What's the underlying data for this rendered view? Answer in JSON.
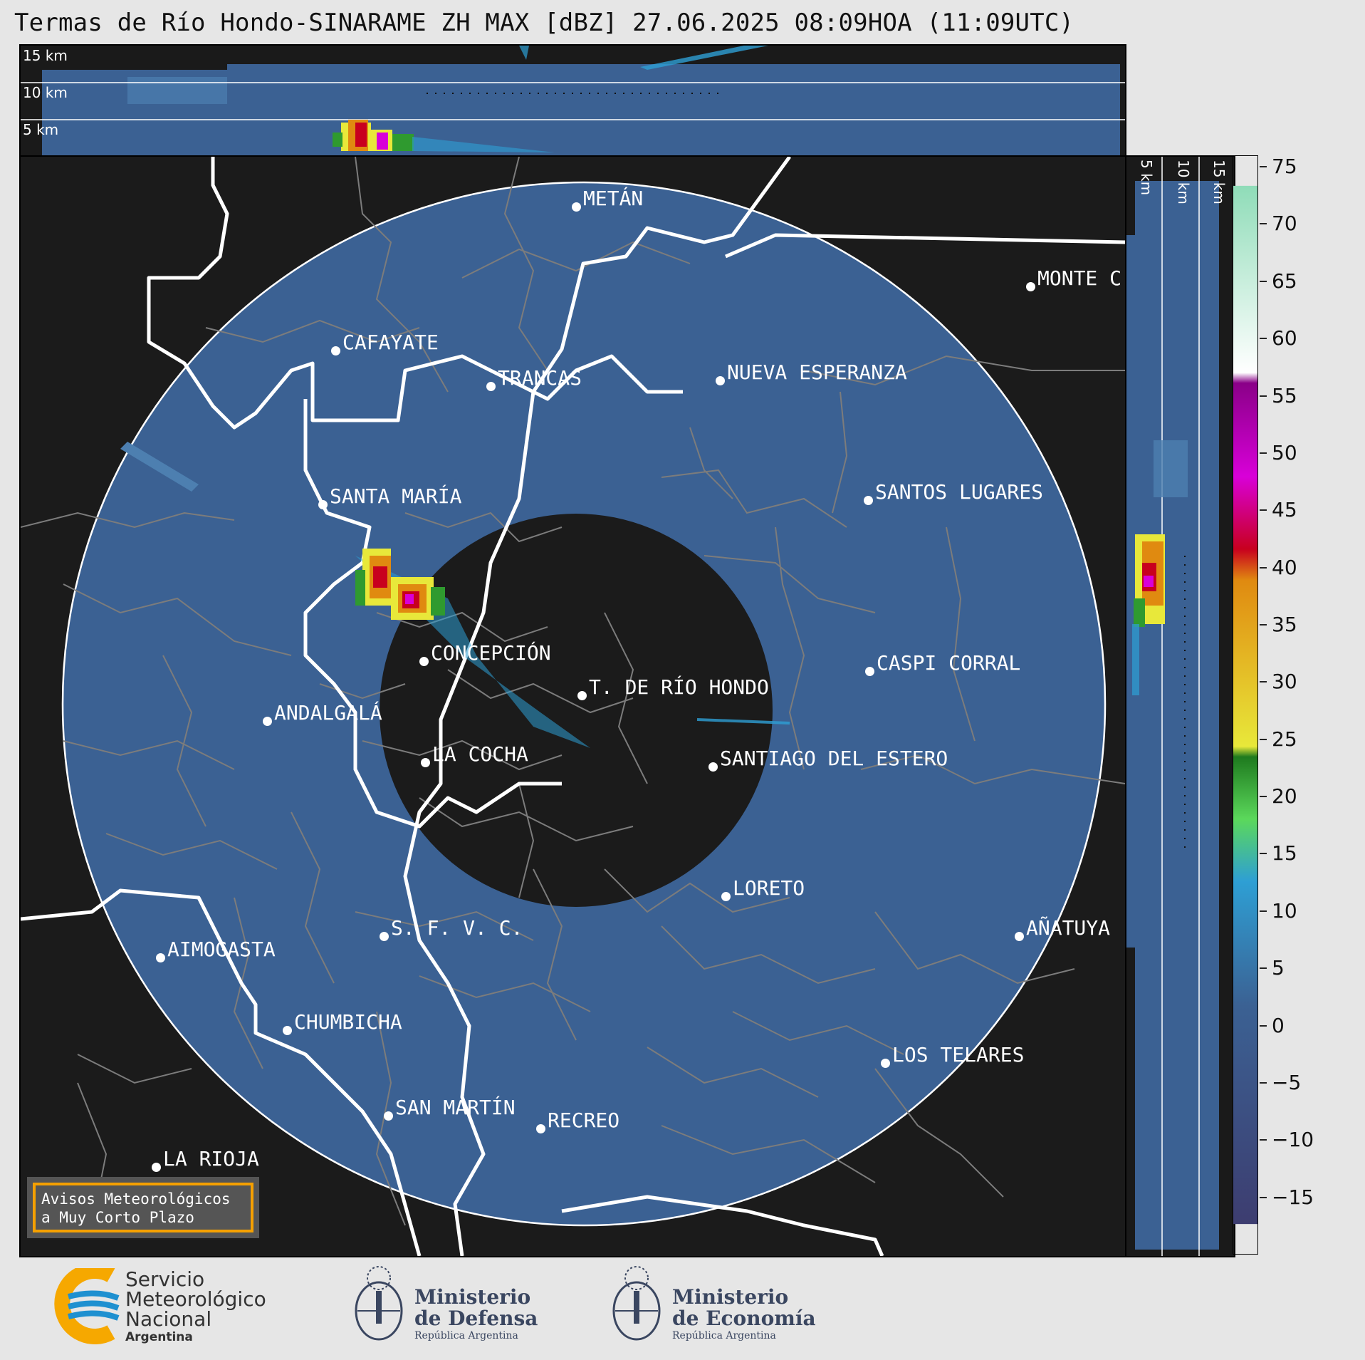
{
  "title": "Termas de Río Hondo-SINARAME ZH MAX [dBZ] 27.06.2025 08:09HOA (11:09UTC)",
  "top_panel": {
    "altitude_labels": [
      "15 km",
      "10 km",
      "5 km"
    ]
  },
  "right_panel": {
    "altitude_labels": [
      "5 km",
      "10 km",
      "15 km"
    ]
  },
  "cities": [
    {
      "name": "METÁN"
    },
    {
      "name": "MONTE C"
    },
    {
      "name": "CAFAYATE"
    },
    {
      "name": "TRANCAS"
    },
    {
      "name": "NUEVA ESPERANZA"
    },
    {
      "name": "SANTA MARÍA"
    },
    {
      "name": "SANTOS LUGARES"
    },
    {
      "name": "CONCEPCIÓN"
    },
    {
      "name": "CASPI CORRAL"
    },
    {
      "name": "T. DE RÍO HONDO"
    },
    {
      "name": "ANDALGALÁ"
    },
    {
      "name": "LA COCHA"
    },
    {
      "name": "SANTIAGO DEL ESTERO"
    },
    {
      "name": "LORETO"
    },
    {
      "name": "S. F. V. C."
    },
    {
      "name": "AÑATUYA"
    },
    {
      "name": "AIMOGASTA"
    },
    {
      "name": "CHUMBICHA"
    },
    {
      "name": "LOS TELARES"
    },
    {
      "name": "SAN MARTÍN"
    },
    {
      "name": "RECREO"
    },
    {
      "name": "LA RIOJA"
    }
  ],
  "warning_box": {
    "line1": "Avisos Meteorológicos",
    "line2": "a Muy Corto Plazo"
  },
  "colorbar": {
    "unit": "dBZ",
    "min": -20,
    "max": 76,
    "tick_values": [
      75,
      70,
      65,
      60,
      55,
      50,
      45,
      40,
      35,
      30,
      25,
      20,
      15,
      10,
      5,
      0,
      -5,
      -10,
      -15
    ],
    "tick_labels": [
      "75",
      "70",
      "65",
      "60",
      "55",
      "50",
      "45",
      "40",
      "35",
      "30",
      "25",
      "20",
      "15",
      "10",
      "5",
      "0",
      "−5",
      "−10",
      "−15"
    ],
    "colors": {
      "low_dark": "#3d3d70",
      "blue_base": "#3b6193",
      "light_blue": "#2e9fd4",
      "green": "#2f9a2f",
      "yellow": "#e8e83a",
      "orange": "#e08a10",
      "red": "#c8001e",
      "magenta": "#d800d8",
      "white": "#ffffff",
      "mint": "#8fdcb8"
    }
  },
  "logos": {
    "smn": {
      "line1": "Servicio",
      "line2": "Meteorológico",
      "line3": "Nacional",
      "line4": "Argentina"
    },
    "defensa": {
      "line1": "Ministerio",
      "line2": "de Defensa",
      "line3": "República Argentina"
    },
    "economia": {
      "line1": "Ministerio",
      "line2": "de Economía",
      "line3": "República Argentina"
    }
  }
}
